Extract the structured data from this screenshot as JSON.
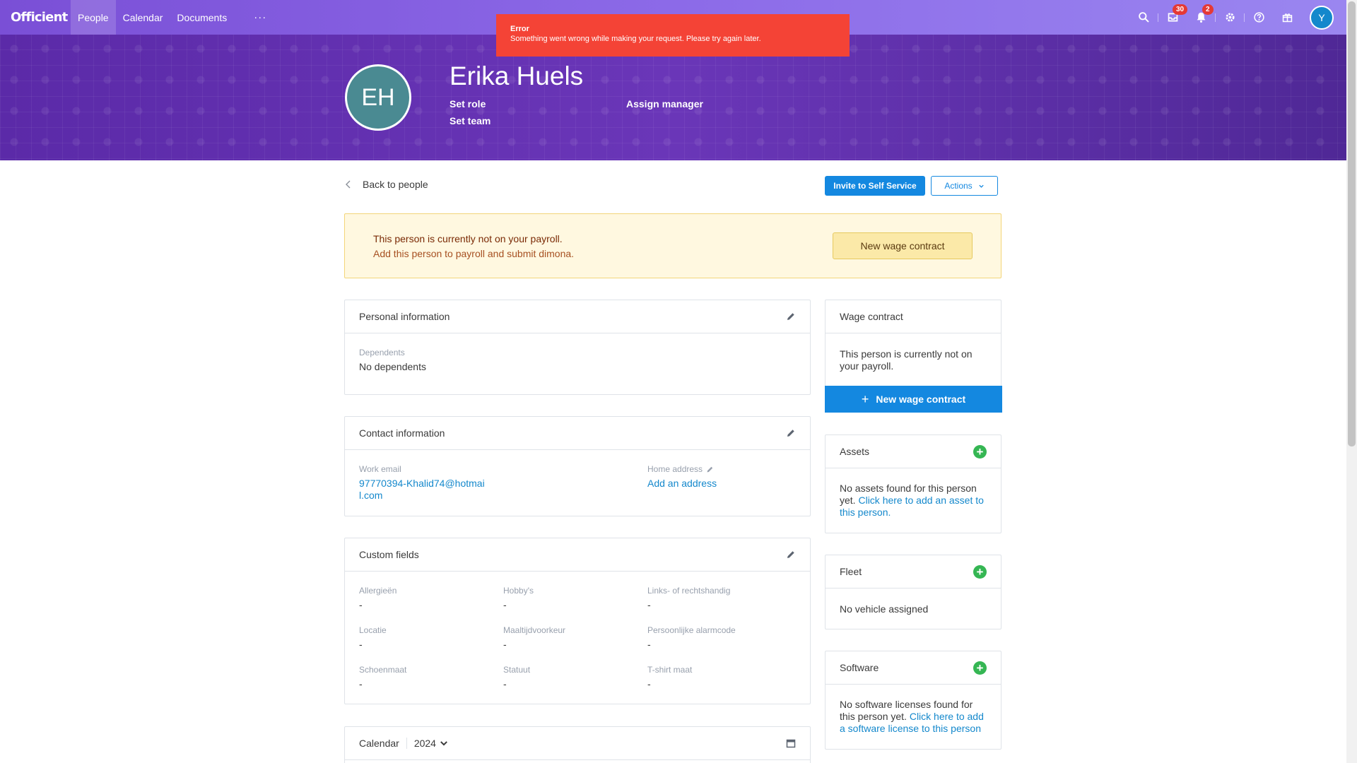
{
  "nav": {
    "logo": "Officient",
    "items": [
      {
        "label": "People",
        "active": true
      },
      {
        "label": "Calendar",
        "active": false
      },
      {
        "label": "Documents",
        "active": false
      }
    ],
    "more": "···",
    "inbox_badge": "30",
    "notif_badge": "2",
    "user_initial": "Y"
  },
  "toast": {
    "title": "Error",
    "message": "Something went wrong while making your request. Please try again later."
  },
  "profile": {
    "initials": "EH",
    "name": "Erika Huels",
    "set_role": "Set role",
    "set_team": "Set team",
    "assign_manager": "Assign manager"
  },
  "toolbar": {
    "back": "Back to people",
    "invite": "Invite to Self Service",
    "actions": "Actions"
  },
  "payroll_warning": {
    "title": "This person is currently not on your payroll.",
    "subtitle": "Add this person to payroll and submit dimona.",
    "button": "New wage contract"
  },
  "personal": {
    "title": "Personal information",
    "dependents_label": "Dependents",
    "dependents_value": "No dependents"
  },
  "contact": {
    "title": "Contact information",
    "work_email_label": "Work email",
    "work_email_line1": "97770394-Khalid74@hotmai",
    "work_email_line2": "l.com",
    "home_address_label": "Home address",
    "home_address_value": "Add an address"
  },
  "custom": {
    "title": "Custom fields",
    "fields": [
      {
        "label": "Allergieën",
        "value": "-"
      },
      {
        "label": "Hobby's",
        "value": "-"
      },
      {
        "label": "Links- of rechtshandig",
        "value": "-"
      },
      {
        "label": "Locatie",
        "value": "-"
      },
      {
        "label": "Maaltijdvoorkeur",
        "value": "-"
      },
      {
        "label": "Persoonlijke alarmcode",
        "value": "-"
      },
      {
        "label": "Schoenmaat",
        "value": "-"
      },
      {
        "label": "Statuut",
        "value": "-"
      },
      {
        "label": "T-shirt maat",
        "value": "-"
      }
    ]
  },
  "calendar": {
    "title": "Calendar",
    "year": "2024"
  },
  "wage": {
    "title": "Wage contract",
    "text_line1": "This person is currently not on",
    "text_line2": "your payroll.",
    "button": "New wage contract"
  },
  "assets": {
    "title": "Assets",
    "line1": "No assets found for this person",
    "line2_text": "yet.",
    "line2_link": "Click here to add an asset to",
    "line3_link": "this person."
  },
  "fleet": {
    "title": "Fleet",
    "text": "No vehicle assigned"
  },
  "software": {
    "title": "Software",
    "line1": "No software licenses found for",
    "line2_text": "this person yet.",
    "line2_link": "Click here to add",
    "line3_link": "a software license to this person"
  },
  "colors": {
    "accent": "#1488e0",
    "nav_gradient_start": "#7a4fd6",
    "banner": "#5a2ea6",
    "error": "#f44336",
    "warning_bg": "#fff8e0",
    "add_green": "#35b653"
  }
}
